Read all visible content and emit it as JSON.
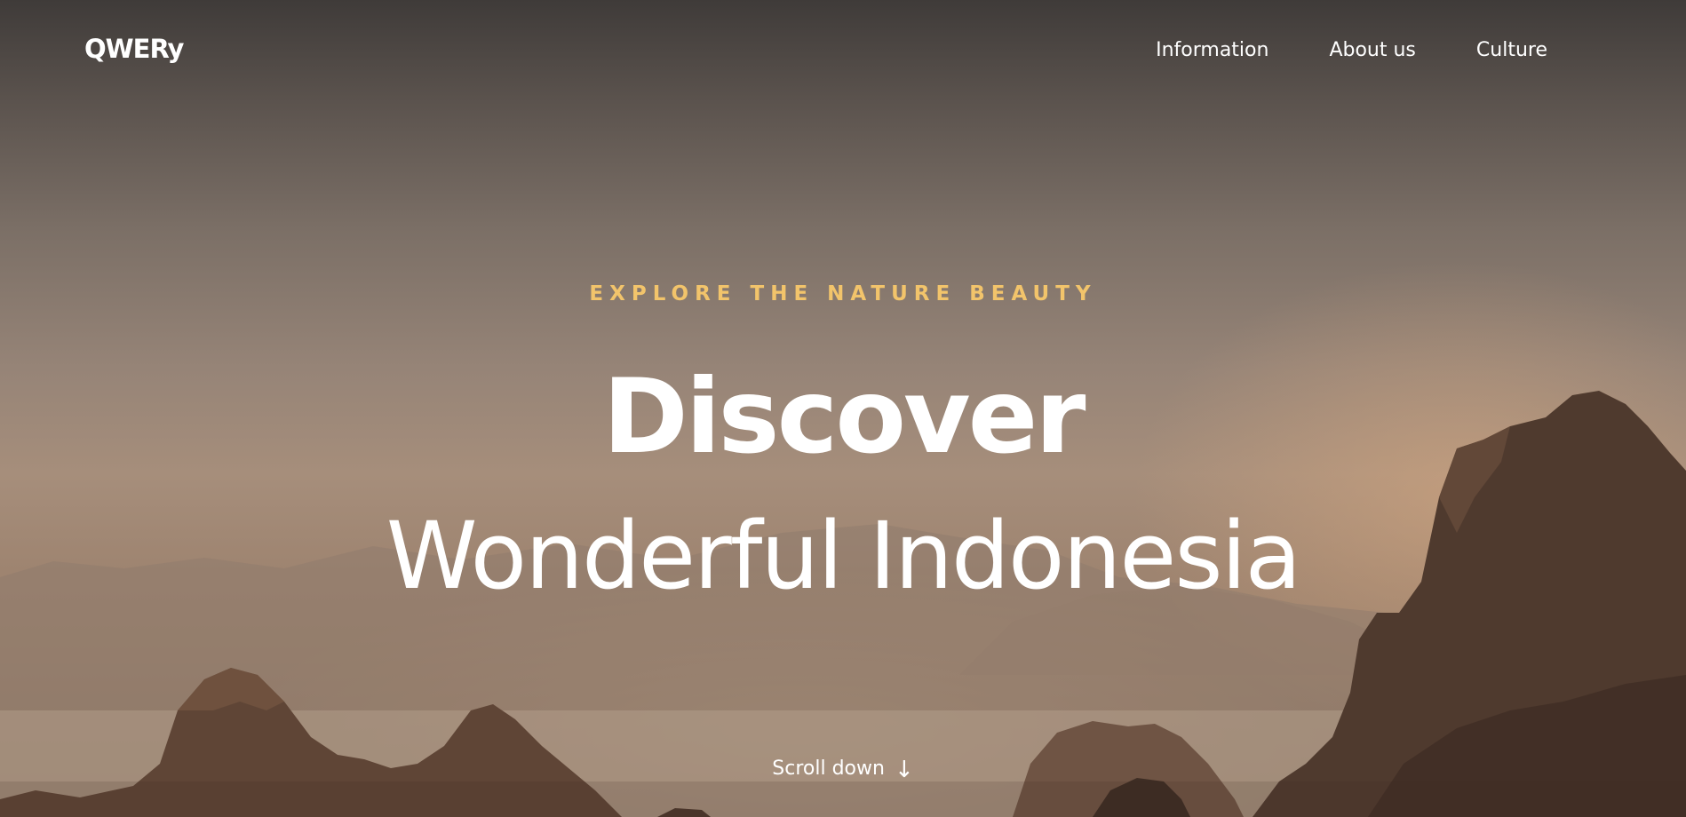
{
  "brand": {
    "logo": "QWERy"
  },
  "nav": {
    "items": [
      {
        "label": "Information"
      },
      {
        "label": "About us"
      },
      {
        "label": "Culture"
      }
    ]
  },
  "hero": {
    "kicker": "EXPLORE THE NATURE BEAUTY",
    "title_line1": "Discover",
    "title_line2": "Wonderful Indonesia",
    "scroll_label": "Scroll down",
    "scroll_icon": "arrow-down-icon"
  },
  "colors": {
    "accent": "#f2c46b",
    "text": "#ffffff"
  }
}
